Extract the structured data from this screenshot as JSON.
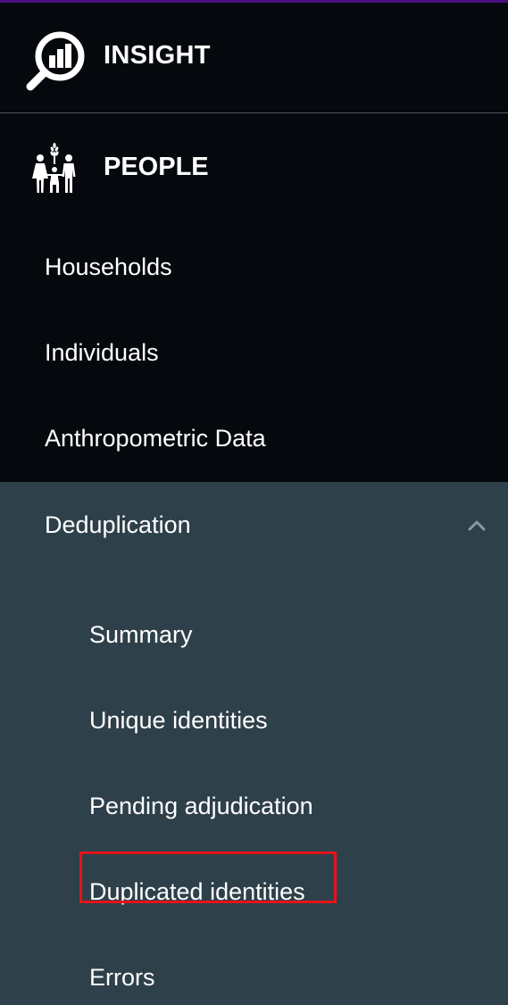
{
  "theme": {
    "top_accent_color": "#4b0e7f",
    "sidebar_background": "#05080d",
    "submenu_background": "#2e404a",
    "highlight_color": "#e4141b"
  },
  "brand": {
    "label": "INSIGHT",
    "icon": "magnifier-chart-icon"
  },
  "section": {
    "label": "PEOPLE",
    "icon": "family-icon"
  },
  "nav": {
    "items": [
      {
        "label": "Households"
      },
      {
        "label": "Individuals"
      },
      {
        "label": "Anthropometric Data"
      }
    ]
  },
  "deduplication": {
    "label": "Deduplication",
    "expanded": true,
    "chevron_icon": "chevron-up-icon",
    "items": [
      {
        "label": "Summary"
      },
      {
        "label": "Unique identities"
      },
      {
        "label": "Pending adjudication"
      },
      {
        "label": "Duplicated identities",
        "highlighted": true
      },
      {
        "label": "Errors"
      }
    ]
  }
}
